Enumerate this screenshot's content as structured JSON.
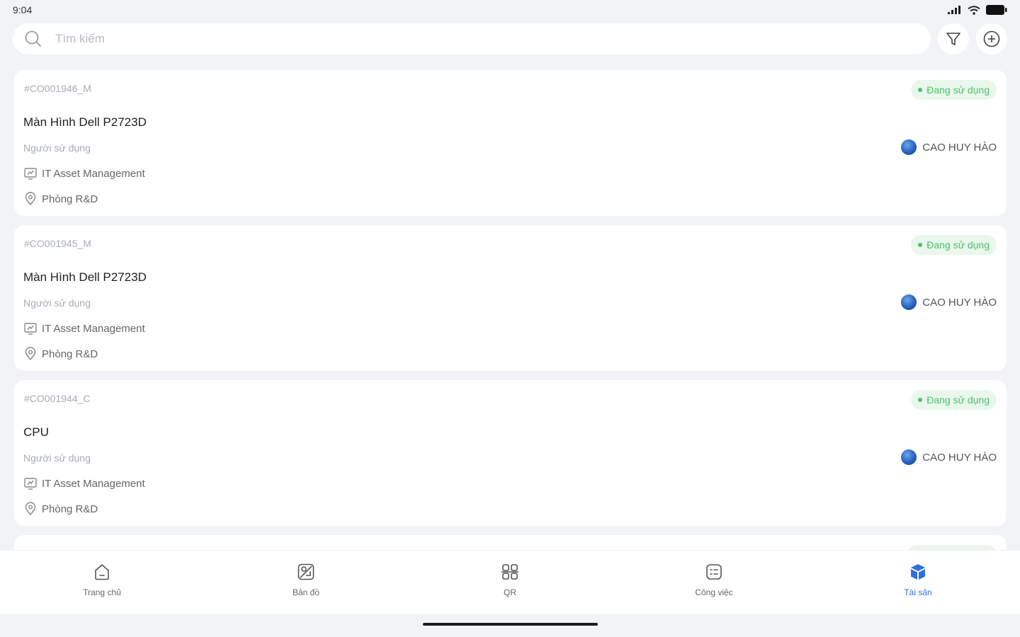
{
  "status_bar": {
    "time": "9:04"
  },
  "search": {
    "placeholder": "Tìm kiếm",
    "value": ""
  },
  "colors": {
    "active": "#2f6fe0",
    "status_green": "#4cc06b",
    "background": "#f2f3f7"
  },
  "assets": [
    {
      "code": "#CO001946_M",
      "status": "Đang sử dụng",
      "name": "Màn Hình Dell P2723D",
      "user_label": "Người sử dụng",
      "user_name": "CAO HUY HÀO",
      "organization": "IT Asset Management",
      "location": "Phòng R&D"
    },
    {
      "code": "#CO001945_M",
      "status": "Đang sử dụng",
      "name": "Màn Hình Dell P2723D",
      "user_label": "Người sử dụng",
      "user_name": "CAO HUY HÀO",
      "organization": "IT Asset Management",
      "location": "Phòng R&D"
    },
    {
      "code": "#CO001944_C",
      "status": "Đang sử dụng",
      "name": "CPU",
      "user_label": "Người sử dụng",
      "user_name": "CAO HUY HÀO",
      "organization": "IT Asset Management",
      "location": "Phòng R&D"
    }
  ],
  "nav": [
    {
      "label": "Trang chủ",
      "icon": "home-icon"
    },
    {
      "label": "Bản đồ",
      "icon": "map-icon"
    },
    {
      "label": "QR",
      "icon": "qr-icon"
    },
    {
      "label": "Công việc",
      "icon": "task-icon"
    },
    {
      "label": "Tài sản",
      "icon": "asset-box-icon",
      "active": true
    }
  ]
}
